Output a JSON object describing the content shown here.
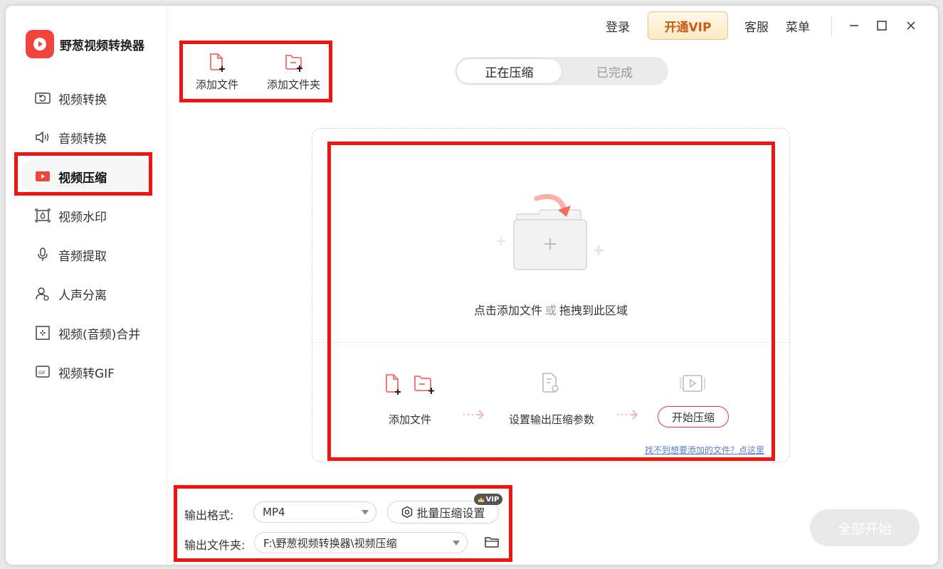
{
  "app": {
    "title": "野葱视频转换器"
  },
  "sidebar": {
    "items": [
      {
        "label": "视频转换",
        "icon": "video-convert-icon",
        "active": false
      },
      {
        "label": "音频转换",
        "icon": "audio-convert-icon",
        "active": false
      },
      {
        "label": "视频压缩",
        "icon": "video-compress-icon",
        "active": true
      },
      {
        "label": "视频水印",
        "icon": "watermark-icon",
        "active": false
      },
      {
        "label": "音频提取",
        "icon": "audio-extract-icon",
        "active": false
      },
      {
        "label": "人声分离",
        "icon": "vocal-separate-icon",
        "active": false
      },
      {
        "label": "视频(音频)合并",
        "icon": "merge-icon",
        "active": false
      },
      {
        "label": "视频转GIF",
        "icon": "gif-icon",
        "active": false
      }
    ]
  },
  "topbar": {
    "login": "登录",
    "vip": "开通VIP",
    "service": "客服",
    "menu": "菜单"
  },
  "toolbar": {
    "add_file": "添加文件",
    "add_folder": "添加文件夹"
  },
  "tabs": [
    {
      "label": "正在压缩",
      "active": true
    },
    {
      "label": "已完成",
      "active": false
    }
  ],
  "dropzone": {
    "hint_click": "点击添加文件",
    "hint_or": "或",
    "hint_drag": "拖拽到此区域",
    "steps": {
      "add_file": "添加文件",
      "set_params": "设置输出压缩参数",
      "start": "开始压缩"
    },
    "help_link": "找不到想要添加的文件？点这里"
  },
  "bottom": {
    "format_label": "输出格式:",
    "format_value": "MP4",
    "batch_settings": "批量压缩设置",
    "vip_badge": "VIP",
    "folder_label": "输出文件夹:",
    "folder_value": "F:\\野葱视频转换器\\视频压缩",
    "start_all": "全部开始"
  },
  "colors": {
    "accent": "#f0453c",
    "highlight_box": "#f0150f",
    "vip_text": "#cc5a15"
  }
}
